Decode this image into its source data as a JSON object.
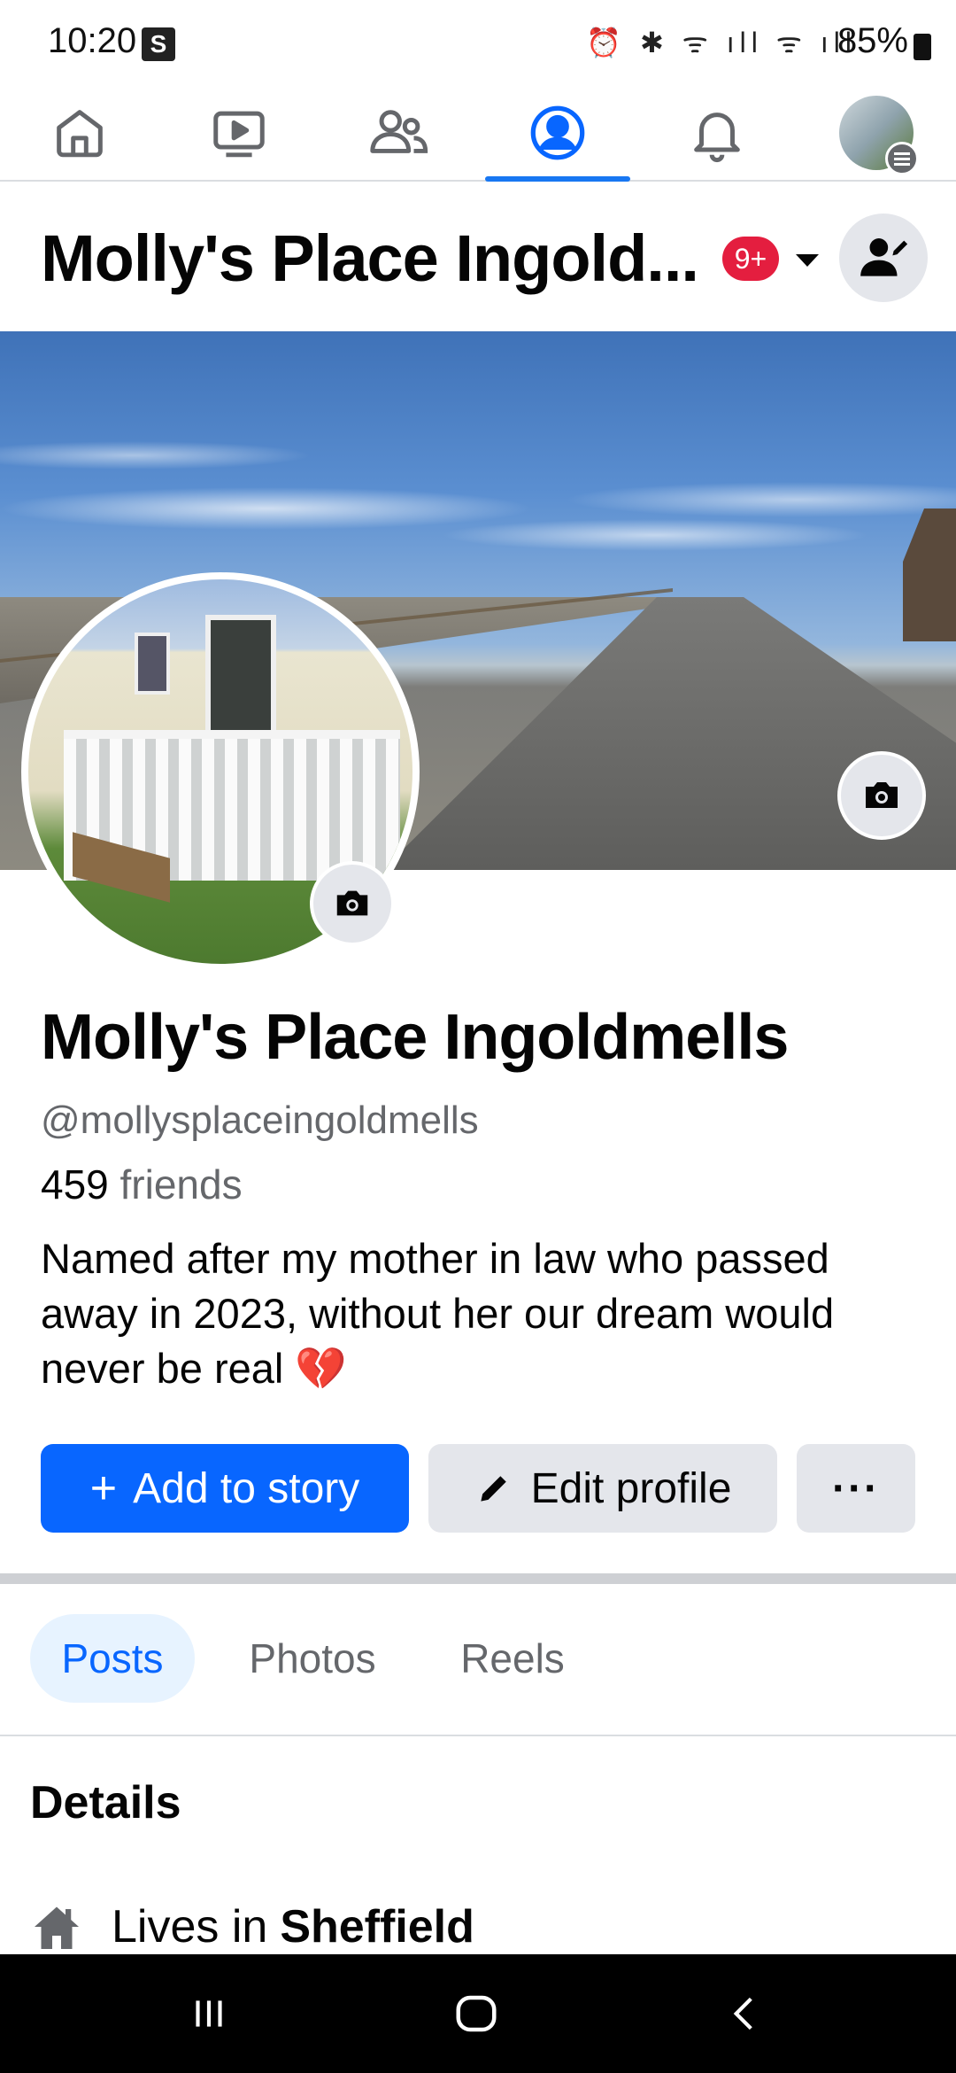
{
  "status_bar": {
    "time": "10:20",
    "carrier_badge": "S",
    "icons": "⏰ ✱ ᯤ ıll ᯤ ıll",
    "battery": "85%"
  },
  "nav": {
    "items": [
      "home-icon",
      "video-icon",
      "friends-icon",
      "profile-icon",
      "bell-icon",
      "menu-avatar"
    ],
    "active_index": 3
  },
  "header": {
    "title": "Molly's Place Ingold...",
    "notification_badge": "9+"
  },
  "profile": {
    "name": "Molly's Place Ingoldmells",
    "handle": "@mollysplaceingoldmells",
    "friends_count": "459",
    "friends_label": "friends",
    "bio": "Named after my mother in law who passed away in 2023, without her our dream would never be real 💔"
  },
  "actions": {
    "add_story_label": "Add to story",
    "edit_profile_label": "Edit profile",
    "more_label": "···"
  },
  "tabs": [
    "Posts",
    "Photos",
    "Reels"
  ],
  "details": {
    "title": "Details",
    "lives_in_prefix": "Lives in",
    "lives_in_place": "Sheffield"
  },
  "colors": {
    "accent": "#0866ff",
    "badge": "#e41e3f",
    "secondary_text": "#65676b",
    "button_bg": "#e4e6eb"
  }
}
